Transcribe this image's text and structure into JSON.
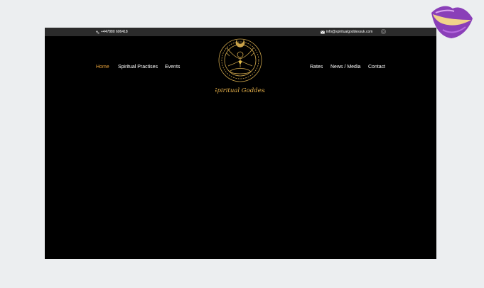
{
  "topbar": {
    "phone": "+447880 606418",
    "email": "info@spiritualgoddessuk.com",
    "phone_icon": "phone-icon",
    "email_icon": "envelope-icon",
    "social_icon": "instagram-icon"
  },
  "nav": {
    "left": [
      "Home",
      "Spiritual Practises",
      "Events"
    ],
    "right": [
      "Rates",
      "News / Media",
      "Contact"
    ],
    "active": "Home"
  },
  "logo": {
    "text": "Spiritual Goddess",
    "icon": "meditating-goddess-logo"
  },
  "decor": {
    "icon": "purple-lips-icon"
  },
  "colors": {
    "background": "#eceef0",
    "frame": "#000000",
    "topbar": "#2b2b2b",
    "accent": "#e8a23a",
    "logo_gold": "#c9a24a"
  }
}
